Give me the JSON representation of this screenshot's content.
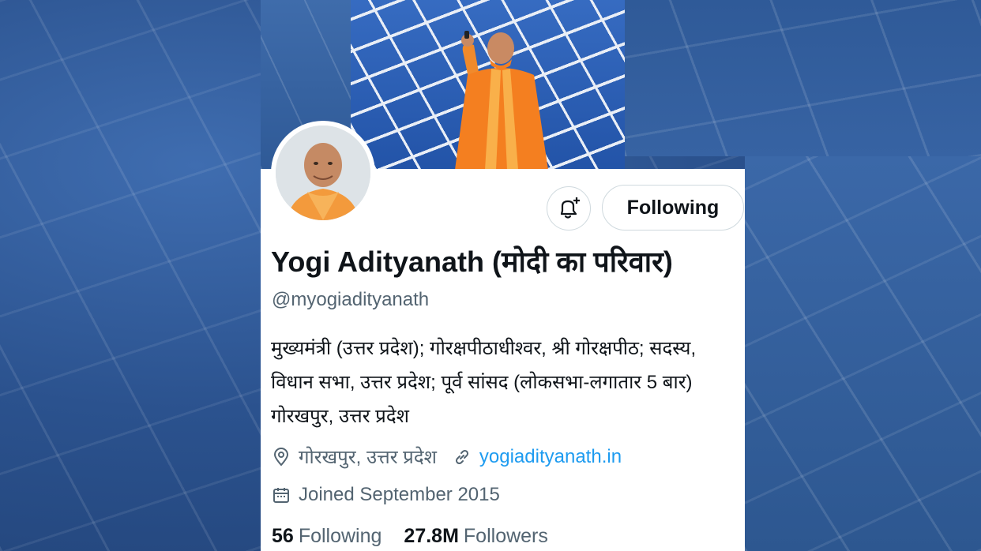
{
  "profile": {
    "display_name": "Yogi Adityanath (मोदी का परिवार)",
    "handle": "@myogiadityanath",
    "bio_lines": [
      "मुख्यमंत्री (उत्तर प्रदेश); गोरक्षपीठाधीश्वर, श्री गोरक्षपीठ; सदस्य,",
      "विधान सभा, उत्तर प्रदेश; पूर्व सांसद (लोकसभा-लगातार 5 बार)",
      "गोरखपुर, उत्तर प्रदेश"
    ],
    "location": "गोरखपुर, उत्तर प्रदेश",
    "website": "yogiadityanath.in",
    "joined": "Joined September 2015",
    "following_count": "56",
    "following_label": "Following",
    "followers_count": "27.8M",
    "followers_label": "Followers"
  },
  "actions": {
    "follow_button_label": "Following",
    "notify_icon": "bell-plus-icon"
  },
  "icons": {
    "location": "location-pin-icon",
    "website": "link-icon",
    "joined": "calendar-icon"
  },
  "colors": {
    "text_primary": "#0f1419",
    "text_secondary": "#536471",
    "link": "#1d9bf0",
    "border": "#cfd9de"
  }
}
